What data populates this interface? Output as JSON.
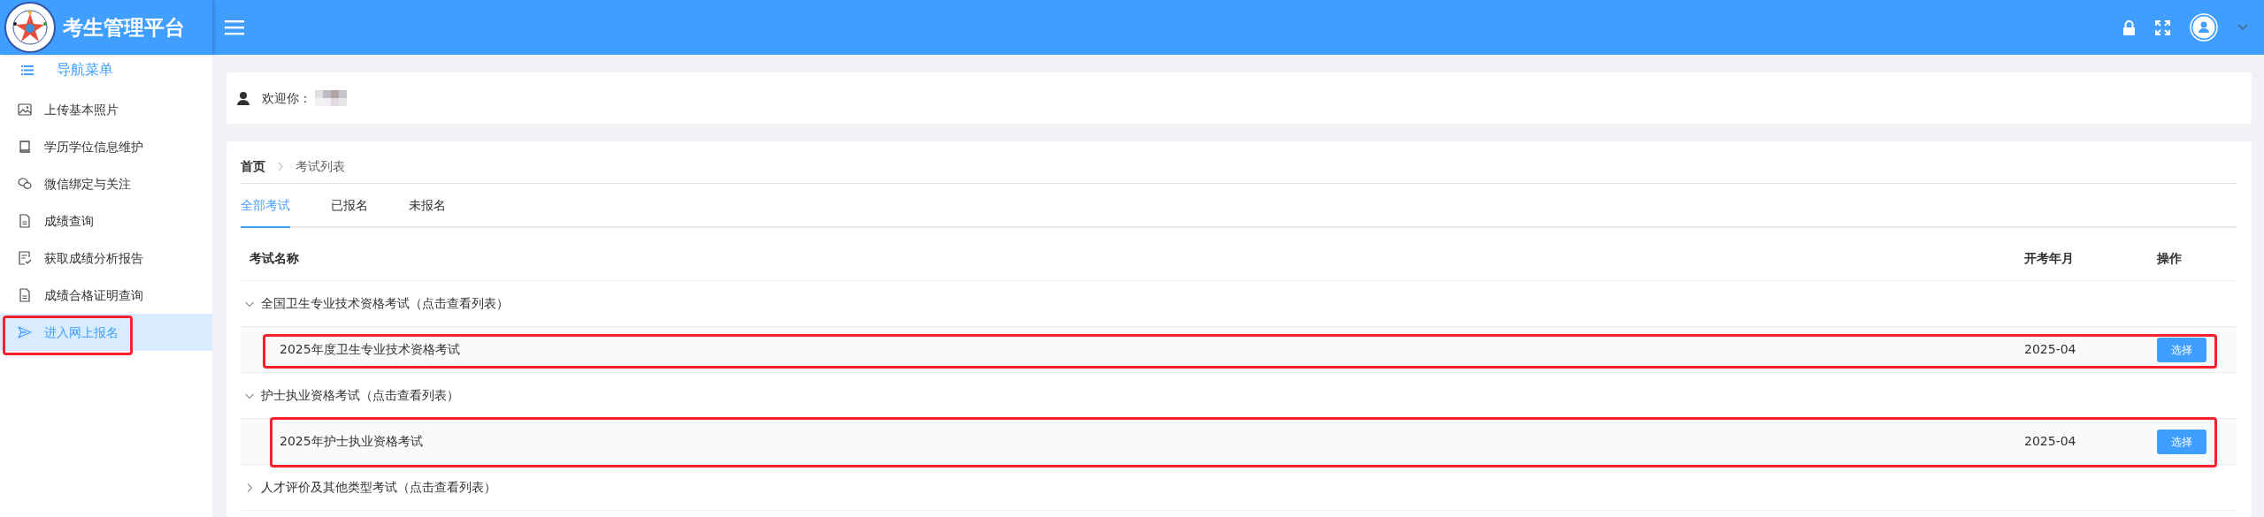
{
  "header": {
    "title": "考生管理平台"
  },
  "sidebar": {
    "title": "导航菜单",
    "items": [
      {
        "label": "上传基本照片",
        "kind": "image",
        "selected": false,
        "highlighted": false
      },
      {
        "label": "学历学位信息维护",
        "kind": "book",
        "selected": false,
        "highlighted": false
      },
      {
        "label": "微信绑定与关注",
        "kind": "chat",
        "selected": false,
        "highlighted": false
      },
      {
        "label": "成绩查询",
        "kind": "document",
        "selected": false,
        "highlighted": false
      },
      {
        "label": "获取成绩分析报告",
        "kind": "report",
        "selected": false,
        "highlighted": false
      },
      {
        "label": "成绩合格证明查询",
        "kind": "document",
        "selected": false,
        "highlighted": false
      },
      {
        "label": "进入网上报名",
        "kind": "send",
        "selected": true,
        "highlighted": true
      }
    ]
  },
  "welcome": {
    "label": "欢迎你："
  },
  "breadcrumb": [
    {
      "label": "首页",
      "current": false
    },
    {
      "label": "考试列表",
      "current": true
    }
  ],
  "tabs": [
    {
      "label": "全部考试",
      "selected": true
    },
    {
      "label": "已报名",
      "selected": false
    },
    {
      "label": "未报名",
      "selected": false
    }
  ],
  "table": {
    "columns": [
      "考试名称",
      "开考年月",
      "操作"
    ],
    "groups": [
      {
        "title": "全国卫生专业技术资格考试（点击查看列表）",
        "expanded": true,
        "rows": [
          {
            "name": "2025年度卫生专业技术资格考试",
            "date": "2025-04",
            "action": "选择",
            "highlighted": true
          }
        ]
      },
      {
        "title": "护士执业资格考试（点击查看列表）",
        "expanded": true,
        "rows": [
          {
            "name": "2025年护士执业资格考试",
            "date": "2025-04",
            "action": "选择",
            "highlighted": true
          }
        ]
      },
      {
        "title": "人才评价及其他类型考试（点击查看列表）",
        "expanded": false
      }
    ]
  }
}
